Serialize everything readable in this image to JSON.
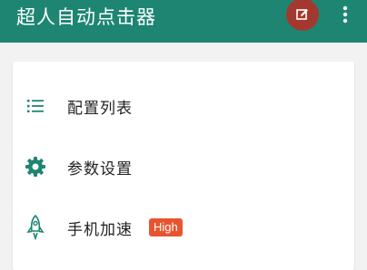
{
  "appbar": {
    "title": "超人自动点击器",
    "edit_icon": "edit-icon",
    "more_icon": "more-vert-icon",
    "color": "#1e8573",
    "fab_color": "#a3392e"
  },
  "menu": {
    "items": [
      {
        "label": "配置列表",
        "icon": "list-icon"
      },
      {
        "label": "参数设置",
        "icon": "gear-icon"
      },
      {
        "label": "手机加速",
        "icon": "rocket-icon",
        "badge": "High"
      }
    ]
  },
  "colors": {
    "accent": "#1e8573",
    "badge": "#e8542f"
  }
}
